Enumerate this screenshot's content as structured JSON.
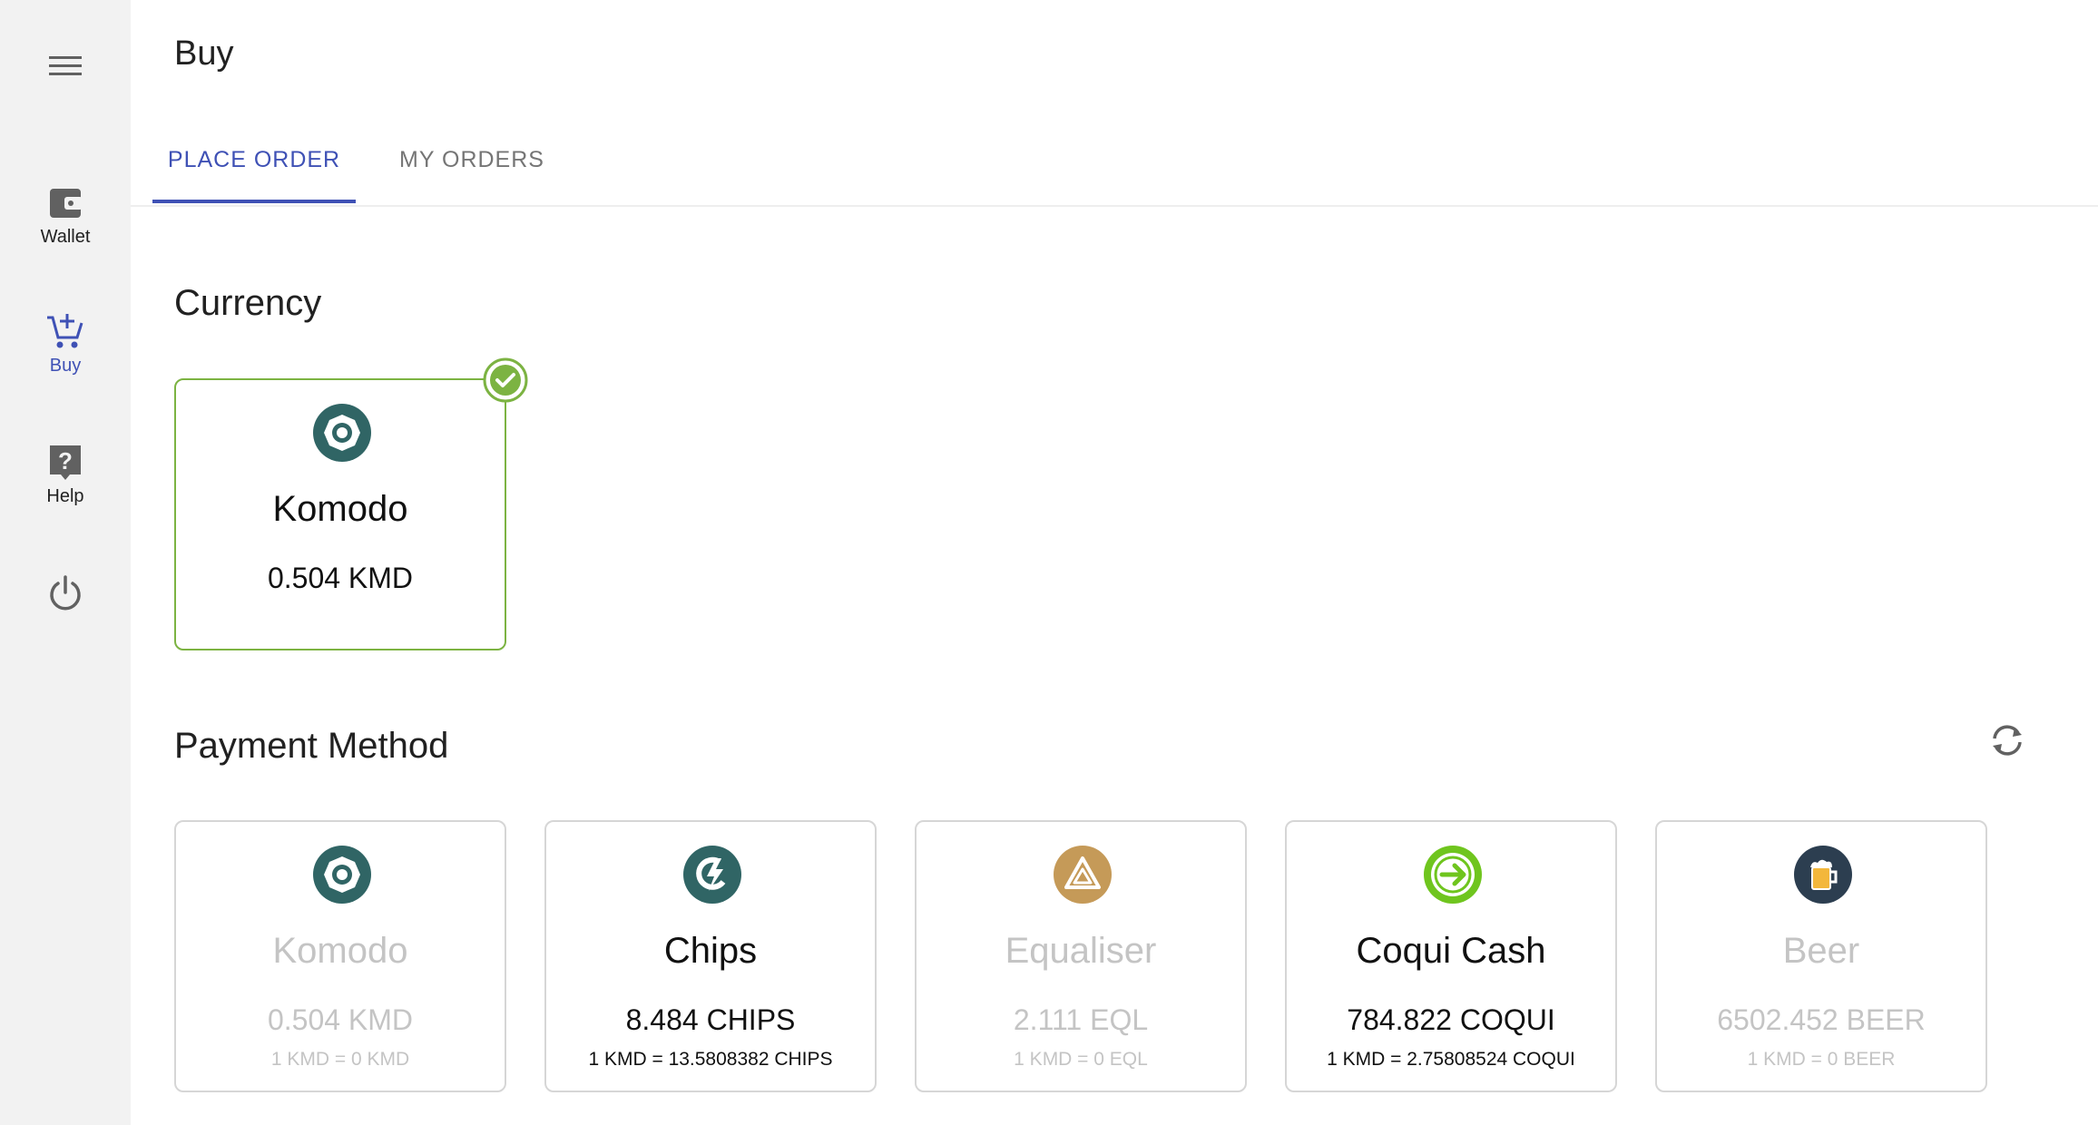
{
  "sidebar": {
    "items": [
      {
        "label": "Wallet",
        "icon": "wallet-icon"
      },
      {
        "label": "Buy",
        "icon": "cart-plus-icon"
      },
      {
        "label": "Help",
        "icon": "help-icon"
      },
      {
        "label": "",
        "icon": "power-icon"
      }
    ]
  },
  "header": {
    "title": "Buy"
  },
  "tabs": [
    {
      "label": "PLACE ORDER",
      "active": true
    },
    {
      "label": "MY ORDERS",
      "active": false
    }
  ],
  "currency": {
    "title": "Currency",
    "selected": {
      "name": "Komodo",
      "balance": "0.504 KMD",
      "icon": "komodo-icon"
    }
  },
  "payment": {
    "title": "Payment Method",
    "methods": [
      {
        "name": "Komodo",
        "balance": "0.504 KMD",
        "rate": "1 KMD = 0 KMD",
        "enabled": false,
        "icon": "komodo-icon"
      },
      {
        "name": "Chips",
        "balance": "8.484 CHIPS",
        "rate": "1 KMD = 13.5808382 CHIPS",
        "enabled": true,
        "icon": "chips-icon"
      },
      {
        "name": "Equaliser",
        "balance": "2.111 EQL",
        "rate": "1 KMD = 0 EQL",
        "enabled": false,
        "icon": "equaliser-icon"
      },
      {
        "name": "Coqui Cash",
        "balance": "784.822 COQUI",
        "rate": "1 KMD = 2.75808524 COQUI",
        "enabled": true,
        "icon": "coqui-icon"
      },
      {
        "name": "Beer",
        "balance": "6502.452 BEER",
        "rate": "1 KMD = 0 BEER",
        "enabled": false,
        "icon": "beer-icon"
      }
    ]
  },
  "colors": {
    "accent": "#3f51b5",
    "selected_border": "#7cb342",
    "komodo": "#306565",
    "equaliser": "#c59a58",
    "coqui": "#6fc51e",
    "beer": "#2c3e50"
  }
}
